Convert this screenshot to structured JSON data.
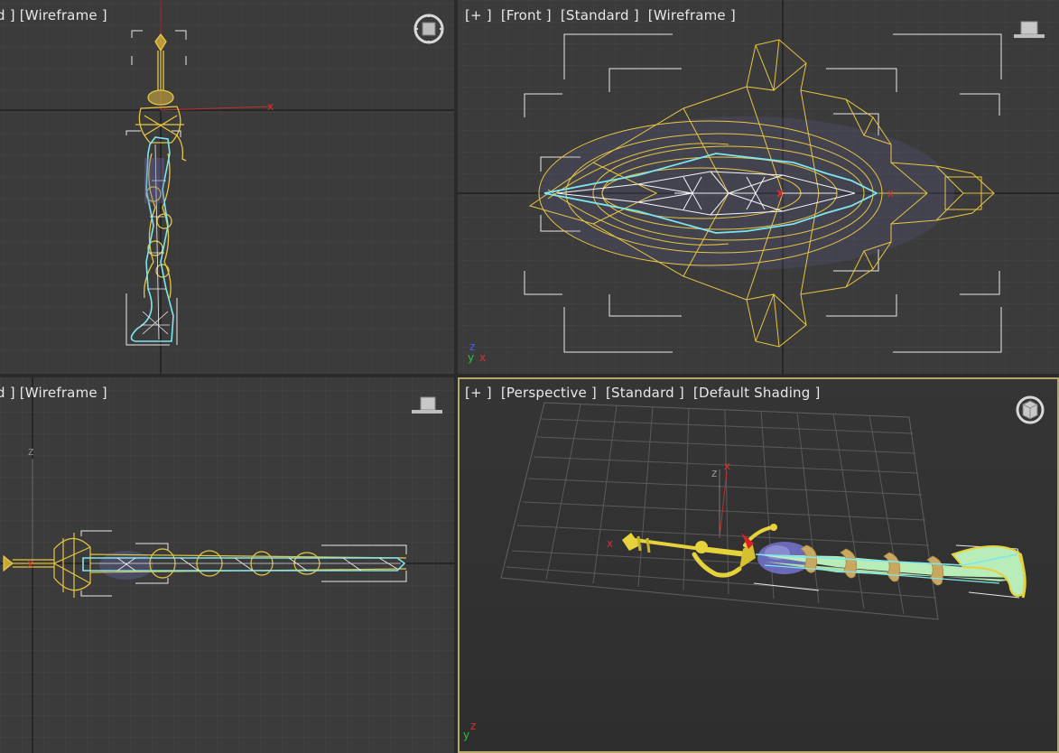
{
  "viewports": {
    "top": {
      "labels": [
        "d ]",
        "[Wireframe ]"
      ]
    },
    "front": {
      "labels": [
        "[+ ]",
        "[Front ]",
        "[Standard ]",
        "[Wireframe ]"
      ]
    },
    "left": {
      "labels": [
        "d ]",
        "[Wireframe ]"
      ]
    },
    "perspective": {
      "labels": [
        "[+ ]",
        "[Perspective ]",
        "[Standard ]",
        "[Default Shading ]"
      ]
    }
  },
  "axes": {
    "x": "x",
    "y": "y",
    "z": "z"
  },
  "icons": {
    "viewcube_top": "viewcube-icon",
    "viewcube_front": "viewcube-icon",
    "viewcube_left": "viewcube-icon",
    "viewcube_persp": "orbit-icon"
  },
  "colors": {
    "wire_yellow": "#e8c640",
    "select_cyan": "#7ee6ee",
    "blade_white": "#f4f4f4",
    "blue_tint": "#6a6ab0",
    "active_border": "#b8a76a",
    "axis_red": "#d83030",
    "axis_green": "#30c040",
    "axis_blue": "#4060ff"
  }
}
